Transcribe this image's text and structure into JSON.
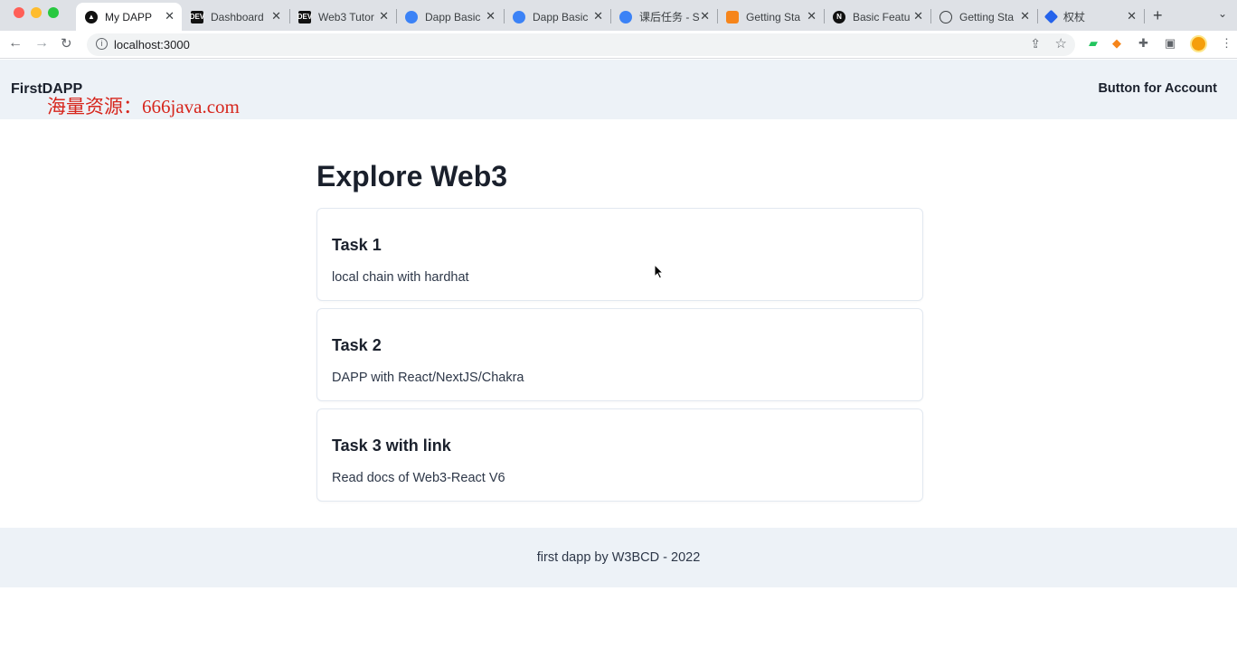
{
  "browser": {
    "tabs": [
      {
        "title": "My DAPP",
        "favicon": "next-logo-icon",
        "active": true
      },
      {
        "title": "Dashboard",
        "favicon": "dev-logo-icon"
      },
      {
        "title": "Web3 Tutor",
        "favicon": "dev-logo-icon"
      },
      {
        "title": "Dapp Basic",
        "favicon": "web-icon"
      },
      {
        "title": "Dapp Basic",
        "favicon": "web-icon"
      },
      {
        "title": "课后任务 - S",
        "favicon": "web-icon"
      },
      {
        "title": "Getting Sta",
        "favicon": "metamask-fox-icon"
      },
      {
        "title": "Basic Featu",
        "favicon": "notion-logo-icon"
      },
      {
        "title": "Getting Sta",
        "favicon": "cloud-icon"
      },
      {
        "title": "权杖",
        "favicon": "diamond-logo-icon"
      }
    ],
    "new_tab": "+",
    "url": "localhost:3000"
  },
  "header": {
    "brand": "FirstDAPP",
    "watermark": "海量资源：666java.com",
    "account_button": "Button for Account"
  },
  "main": {
    "title": "Explore Web3",
    "tasks": [
      {
        "title": "Task 1",
        "description": "local chain with hardhat"
      },
      {
        "title": "Task 2",
        "description": "DAPP with React/NextJS/Chakra"
      },
      {
        "title": "Task 3 with link",
        "description": "Read docs of Web3-React V6"
      }
    ]
  },
  "footer": {
    "text": "first dapp by W3BCD - 2022"
  },
  "colors": {
    "header_bg": "#edf2f7",
    "text": "#1a202c",
    "card_border": "#e2e8f0",
    "watermark": "#d6261d"
  }
}
